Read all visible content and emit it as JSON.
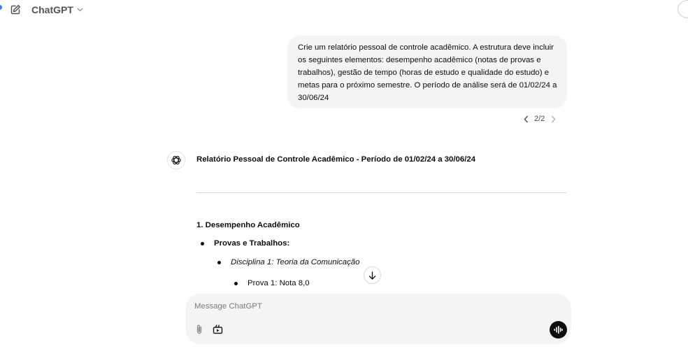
{
  "header": {
    "model_name": "ChatGPT",
    "icons": {
      "new_chat": "compose-icon",
      "model_chevron": "chevron-down-icon"
    }
  },
  "user_message": {
    "text": "Crie um relatório pessoal de controle acadêmico. A estrutura deve incluir os seguintes elementos: desempenho acadêmico (notas de provas e trabalhos), gestão de tempo (horas de estudo e qualidade do estudo) e metas para o próximo semestre. O período de análise será de 01/02/24 a 30/06/24",
    "pager": "2/2"
  },
  "response": {
    "title": "Relatório Pessoal de Controle Acadêmico - Período de 01/02/24 a 30/06/24",
    "section_title": "1. Desempenho Acadêmico",
    "bullet_level1": "Provas e Trabalhos:",
    "bullet_level2": "Disciplina 1: Teoria da Comunicação",
    "bullet_level3": "Prova 1: Nota 8,0"
  },
  "composer": {
    "placeholder": "Message ChatGPT",
    "icons": {
      "attach": "paperclip-icon",
      "tools": "tools-icon",
      "voice": "voice-waveform-icon"
    }
  },
  "colors": {
    "bubble_bg": "#f4f4f4",
    "text": "#0d0d0d",
    "accent_dot": "#2f7cf6"
  }
}
